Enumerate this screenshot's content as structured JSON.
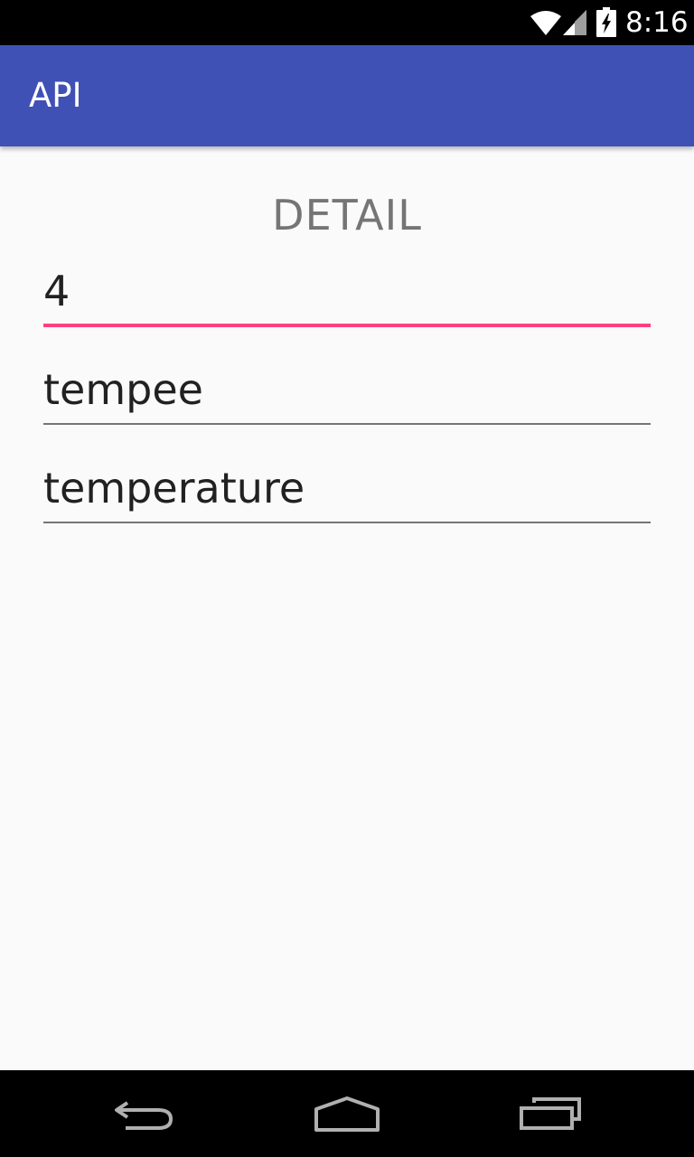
{
  "status_bar": {
    "time": "8:16",
    "icons": [
      "wifi-icon",
      "signal-icon",
      "battery-charging-icon"
    ]
  },
  "app_bar": {
    "title": "API"
  },
  "main": {
    "heading": "DETAIL",
    "fields": [
      {
        "value": "4",
        "focused": true
      },
      {
        "value": "tempee",
        "focused": false
      },
      {
        "value": "temperature",
        "focused": false
      }
    ]
  },
  "nav_bar": {
    "buttons": [
      "back-icon",
      "home-icon",
      "recents-icon"
    ]
  },
  "colors": {
    "primary": "#3f51b5",
    "accent": "#ff4081",
    "background": "#fafafa",
    "text": "#212121",
    "secondary_text": "#757575"
  }
}
